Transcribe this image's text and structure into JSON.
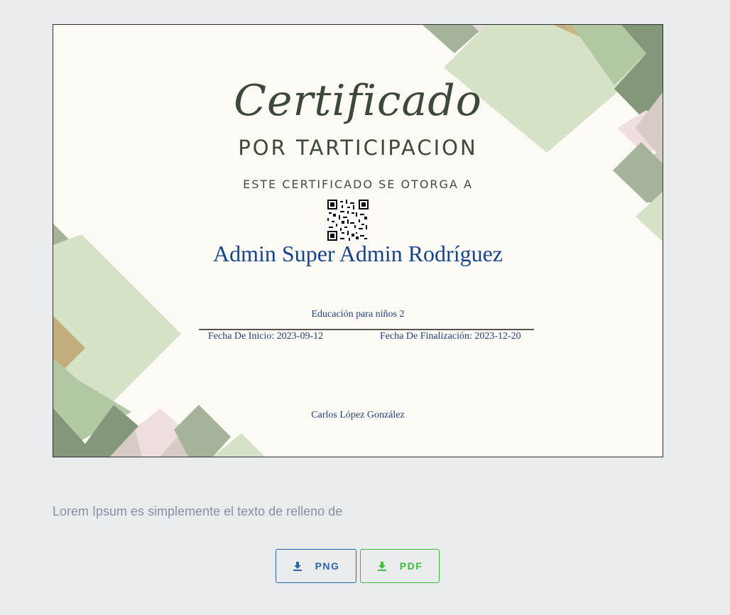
{
  "certificate": {
    "title_script": "Certificado",
    "title_sub": "POR TARTICIPACION",
    "award_line": "ESTE CERTIFICADO SE OTORGA A",
    "recipient": "Admin Super Admin Rodríguez",
    "course": "Educación para niños 2",
    "start_date": "Fecha De Inicio: 2023-09-12",
    "end_date": "Fecha De Finalización: 2023-12-20",
    "signer": "Carlos López González"
  },
  "caption": "Lorem Ipsum es simplemente el texto de relleno de",
  "buttons": {
    "png_label": "PNG",
    "pdf_label": "PDF",
    "png_icon": "download-icon",
    "pdf_icon": "download-icon"
  },
  "colors": {
    "png_accent": "#2e66a6",
    "pdf_accent": "#3fbb3a",
    "recipient_text": "#16458a"
  }
}
